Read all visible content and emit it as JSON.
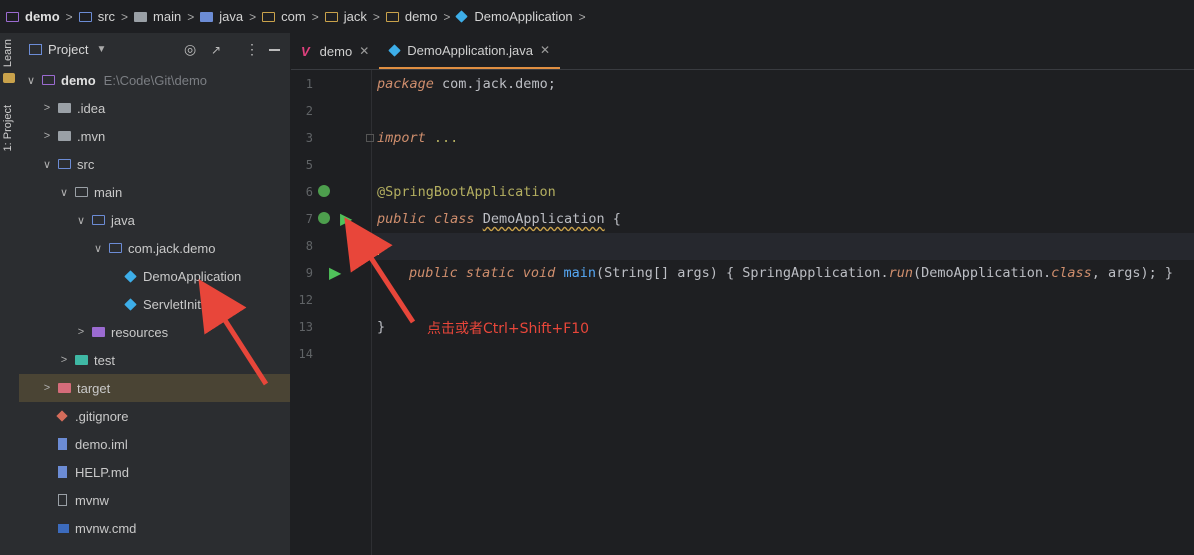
{
  "breadcrumb": {
    "items": [
      "demo",
      "src",
      "main",
      "java",
      "com",
      "jack",
      "demo",
      "DemoApplication"
    ]
  },
  "left_strip": {
    "learn": "Learn",
    "project": "1: Project"
  },
  "project_panel": {
    "title": "Project",
    "tree": [
      {
        "label": "demo",
        "note": "E:\\Code\\Git\\demo"
      },
      {
        "label": ".idea"
      },
      {
        "label": ".mvn"
      },
      {
        "label": "src"
      },
      {
        "label": "main"
      },
      {
        "label": "java"
      },
      {
        "label": "com.jack.demo"
      },
      {
        "label": "DemoApplication"
      },
      {
        "label": "ServletInitializer"
      },
      {
        "label": "resources"
      },
      {
        "label": "test"
      },
      {
        "label": "target"
      },
      {
        "label": ".gitignore"
      },
      {
        "label": "demo.iml"
      },
      {
        "label": "HELP.md"
      },
      {
        "label": "mvnw"
      },
      {
        "label": "mvnw.cmd"
      }
    ]
  },
  "tabs": [
    {
      "label": "demo"
    },
    {
      "label": "DemoApplication.java"
    }
  ],
  "editor": {
    "line_numbers": [
      "1",
      "2",
      "3",
      "5",
      "6",
      "7",
      "8",
      "9",
      "12",
      "13",
      "14"
    ],
    "code": {
      "l1_kw": "package",
      "l1_rest": " com.jack.demo;",
      "l3_kw": "import",
      "l3_rest": " ...",
      "l6": "@SpringBootApplication",
      "l7_kw": "public class",
      "l7_cls": "DemoApplication",
      "l7_rest": " {",
      "l9_kw": "public static void",
      "l9_fn": "main",
      "l9_a": "(String[] args) { SpringApplication.",
      "l9_run": "run",
      "l9_b": "(DemoApplication.",
      "l9_class": "class",
      "l9_c": ", args); }",
      "l13": "}"
    },
    "annotation": "点击或者Ctrl+Shift+F10"
  },
  "colors": {
    "accent": "#e08f42",
    "annotation": "#e8463a",
    "selection": "#4a4434"
  }
}
